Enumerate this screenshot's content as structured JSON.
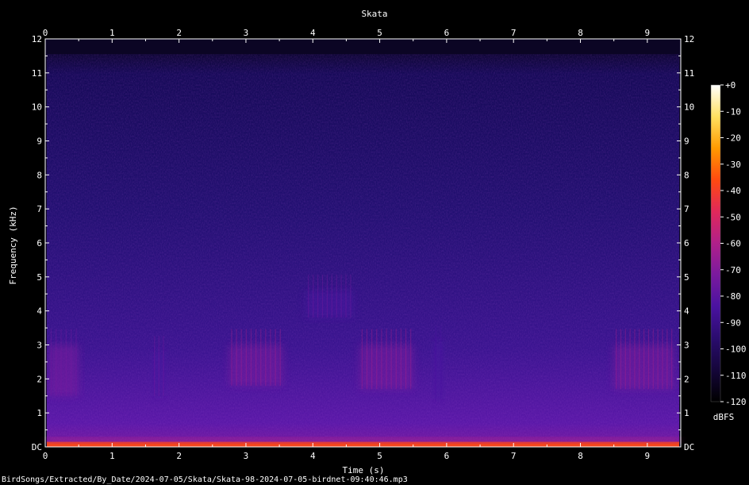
{
  "chart_data": {
    "type": "heatmap",
    "title": "Skata",
    "xlabel": "Time (s)",
    "ylabel": "Frequency (kHz)",
    "xlim": [
      0,
      9.5
    ],
    "ylim": [
      0,
      12
    ],
    "x_ticks": [
      "0",
      "1",
      "2",
      "3",
      "4",
      "5",
      "6",
      "7",
      "8",
      "9"
    ],
    "y_ticks": [
      "DC",
      "1",
      "2",
      "3",
      "4",
      "5",
      "6",
      "7",
      "8",
      "9",
      "10",
      "11",
      "12"
    ],
    "colorbar": {
      "label": "dBFS",
      "ticks": [
        "+0",
        "-10",
        "-20",
        "-30",
        "-40",
        "-50",
        "-60",
        "-70",
        "-80",
        "-90",
        "-100",
        "-110",
        "-120"
      ],
      "range": [
        -120,
        0
      ]
    },
    "features": [
      {
        "t_start": 0.05,
        "t_end": 0.5,
        "f_low": 1.5,
        "f_high": 3.0,
        "level_dbfs": -75
      },
      {
        "t_start": 1.6,
        "t_end": 1.8,
        "f_low": 1.5,
        "f_high": 2.8,
        "level_dbfs": -82
      },
      {
        "t_start": 2.75,
        "t_end": 3.55,
        "f_low": 1.8,
        "f_high": 3.0,
        "level_dbfs": -72
      },
      {
        "t_start": 3.9,
        "t_end": 4.6,
        "f_low": 3.8,
        "f_high": 4.6,
        "level_dbfs": -80
      },
      {
        "t_start": 4.7,
        "t_end": 5.5,
        "f_low": 1.7,
        "f_high": 3.0,
        "level_dbfs": -68
      },
      {
        "t_start": 5.8,
        "t_end": 5.95,
        "f_low": 1.4,
        "f_high": 3.1,
        "level_dbfs": -85
      },
      {
        "t_start": 8.5,
        "t_end": 9.4,
        "f_low": 1.7,
        "f_high": 3.0,
        "level_dbfs": -72
      },
      {
        "t_start": 0.0,
        "t_end": 9.5,
        "f_low": 0.0,
        "f_high": 0.15,
        "level_dbfs": -35
      }
    ]
  },
  "colors": {
    "background": "#000000",
    "axis": "#ffffff",
    "colormap": [
      "#000000",
      "#15063a",
      "#2a0c6e",
      "#4a12a0",
      "#7a1a9e",
      "#b0208a",
      "#e0285a",
      "#ff4a10",
      "#ff9a00",
      "#ffe060",
      "#ffffff"
    ]
  },
  "footer": {
    "path": "BirdSongs/Extracted/By_Date/2024-07-05/Skata/Skata-98-2024-07-05-birdnet-09:40:46.mp3"
  }
}
